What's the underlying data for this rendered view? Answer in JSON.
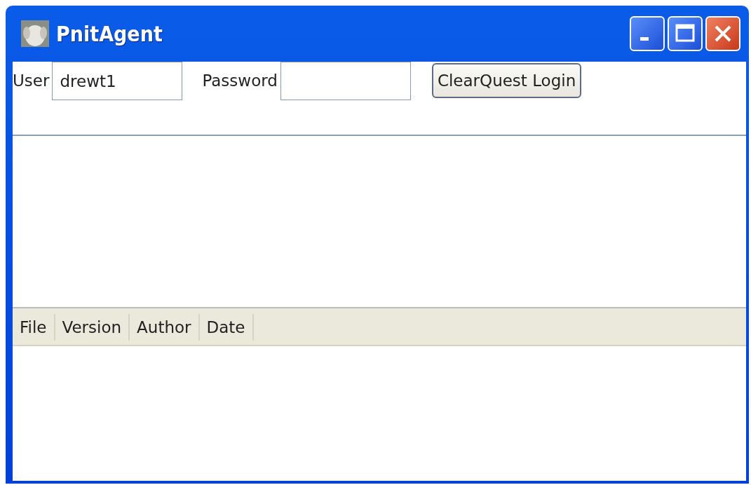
{
  "window": {
    "title": "PnitAgent"
  },
  "login": {
    "user_label": "User",
    "user_value": "drewt1",
    "password_label": "Password",
    "button": "ClearQuest Login"
  },
  "table": {
    "columns": [
      "File",
      "Version",
      "Author",
      "Date"
    ]
  }
}
